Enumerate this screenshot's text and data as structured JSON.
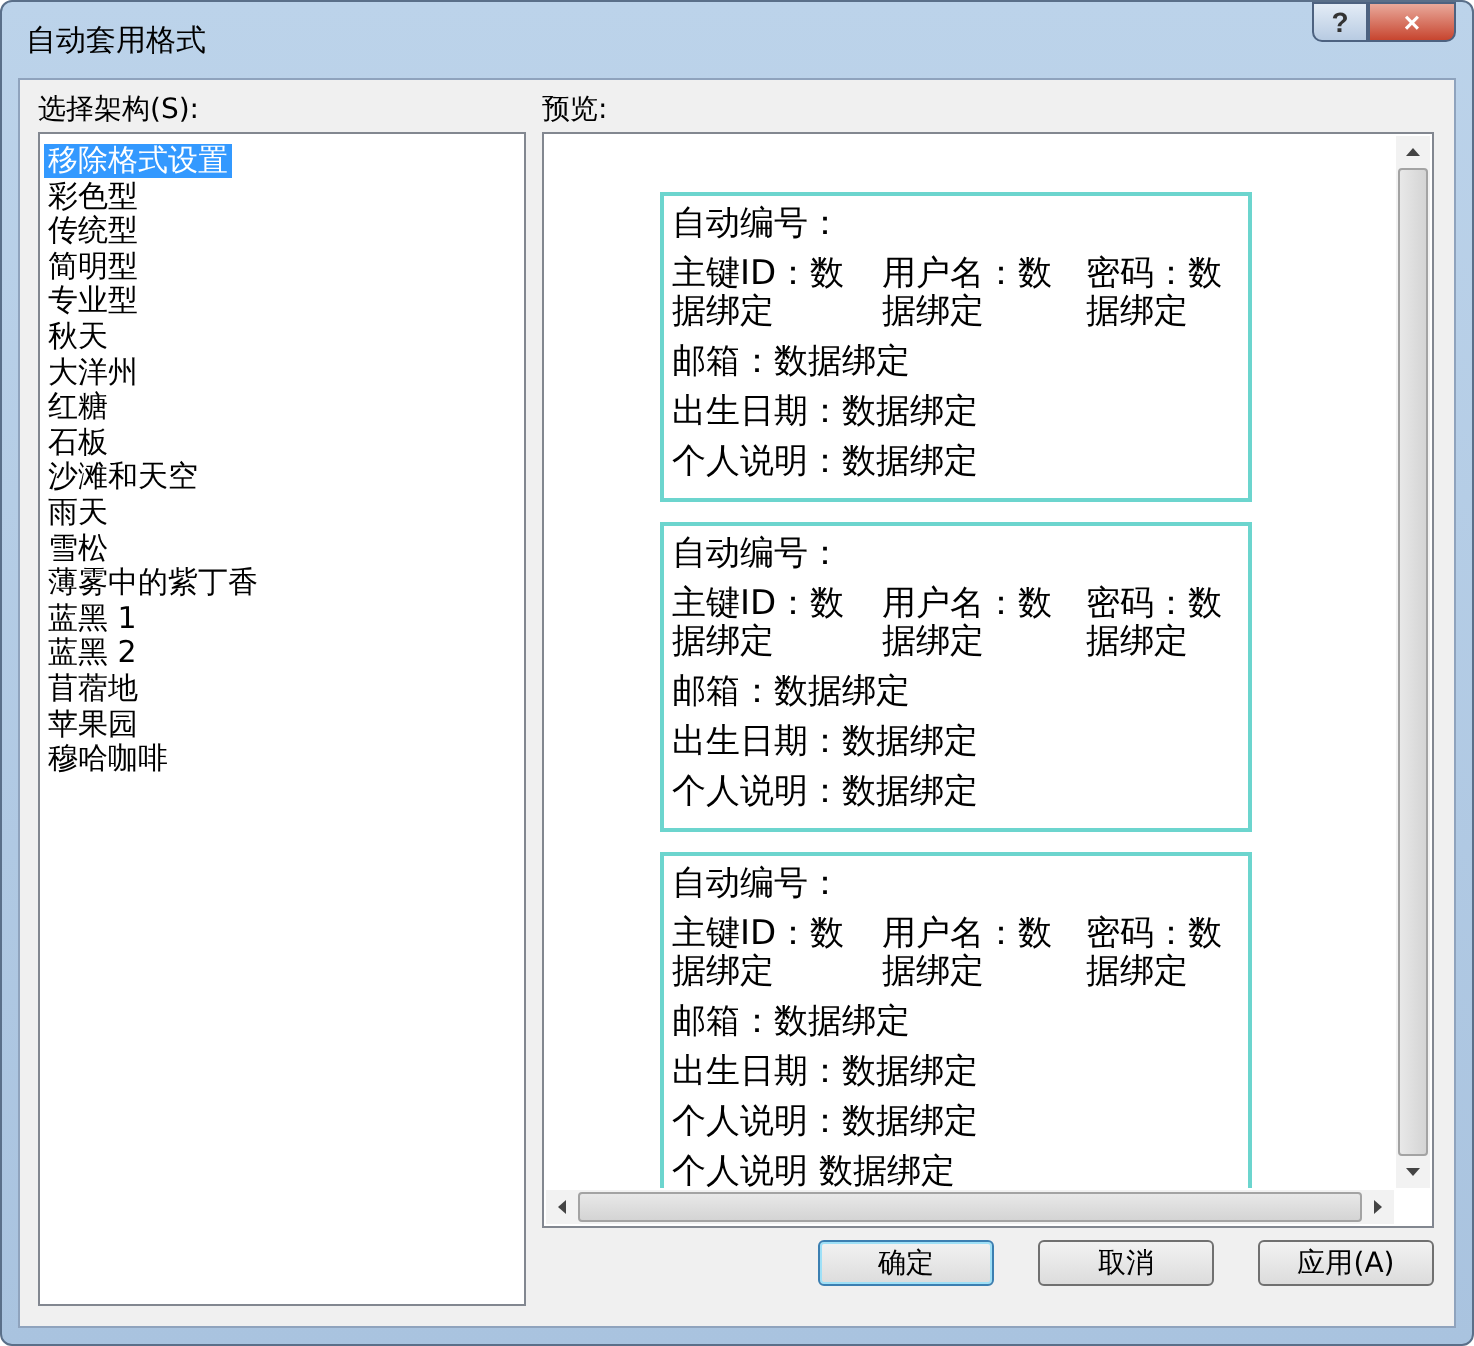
{
  "window": {
    "title": "自动套用格式",
    "help_button": "?",
    "close_button": "×"
  },
  "schema_list": {
    "label": "选择架构(S):",
    "items": [
      {
        "label": "移除格式设置",
        "selected": true
      },
      {
        "label": "彩色型",
        "selected": false
      },
      {
        "label": "传统型",
        "selected": false
      },
      {
        "label": "简明型",
        "selected": false
      },
      {
        "label": "专业型",
        "selected": false
      },
      {
        "label": "秋天",
        "selected": false
      },
      {
        "label": "大洋州",
        "selected": false
      },
      {
        "label": "红糖",
        "selected": false
      },
      {
        "label": "石板",
        "selected": false
      },
      {
        "label": "沙滩和天空",
        "selected": false
      },
      {
        "label": "雨天",
        "selected": false
      },
      {
        "label": "雪松",
        "selected": false
      },
      {
        "label": "薄雾中的紫丁香",
        "selected": false
      },
      {
        "label": "蓝黑 1",
        "selected": false
      },
      {
        "label": "蓝黑 2",
        "selected": false
      },
      {
        "label": "苜蓿地",
        "selected": false
      },
      {
        "label": "苹果园",
        "selected": false
      },
      {
        "label": "穆哈咖啡",
        "selected": false
      }
    ]
  },
  "preview": {
    "label": "预览:",
    "cards": [
      {
        "rows": [
          [
            "自动编号："
          ],
          [
            "主键ID：数据绑定",
            "用户名：数据绑定",
            "密码：数据绑定"
          ],
          [
            "邮箱：数据绑定"
          ],
          [
            "出生日期：数据绑定"
          ],
          [
            "个人说明：数据绑定"
          ]
        ]
      },
      {
        "rows": [
          [
            "自动编号："
          ],
          [
            "主键ID：数据绑定",
            "用户名：数据绑定",
            "密码：数据绑定"
          ],
          [
            "邮箱：数据绑定"
          ],
          [
            "出生日期：数据绑定"
          ],
          [
            "个人说明：数据绑定"
          ]
        ]
      },
      {
        "rows": [
          [
            "自动编号："
          ],
          [
            "主键ID：数据绑定",
            "用户名：数据绑定",
            "密码：数据绑定"
          ],
          [
            "邮箱：数据绑定"
          ],
          [
            "出生日期：数据绑定"
          ],
          [
            "个人说明：数据绑定"
          ],
          [
            "个人说明 数据绑定"
          ]
        ]
      }
    ]
  },
  "buttons": [
    {
      "label": "确定",
      "default": true
    },
    {
      "label": "取消",
      "default": false
    },
    {
      "label": "应用(A)",
      "default": false
    }
  ]
}
